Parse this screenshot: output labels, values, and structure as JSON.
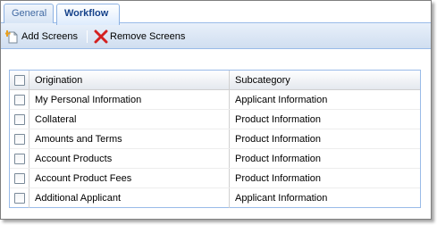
{
  "tabs": [
    {
      "label": "General",
      "active": false
    },
    {
      "label": "Workflow",
      "active": true
    }
  ],
  "toolbar": {
    "add_label": "Add Screens",
    "remove_label": "Remove Screens"
  },
  "grid": {
    "columns": [
      "Origination",
      "Subcategory"
    ],
    "rows": [
      {
        "origination": "My Personal Information",
        "subcategory": "Applicant Information"
      },
      {
        "origination": "Collateral",
        "subcategory": "Product Information"
      },
      {
        "origination": "Amounts and Terms",
        "subcategory": "Product Information"
      },
      {
        "origination": "Account Products",
        "subcategory": "Product Information"
      },
      {
        "origination": "Account Product Fees",
        "subcategory": "Product Information"
      },
      {
        "origination": "Additional Applicant",
        "subcategory": "Applicant Information"
      }
    ]
  },
  "icons": {
    "add": "add-screens-icon",
    "remove": "remove-screens-icon"
  },
  "colors": {
    "accent": "#15428b",
    "border": "#99bbe8",
    "remove_red": "#d42020"
  }
}
